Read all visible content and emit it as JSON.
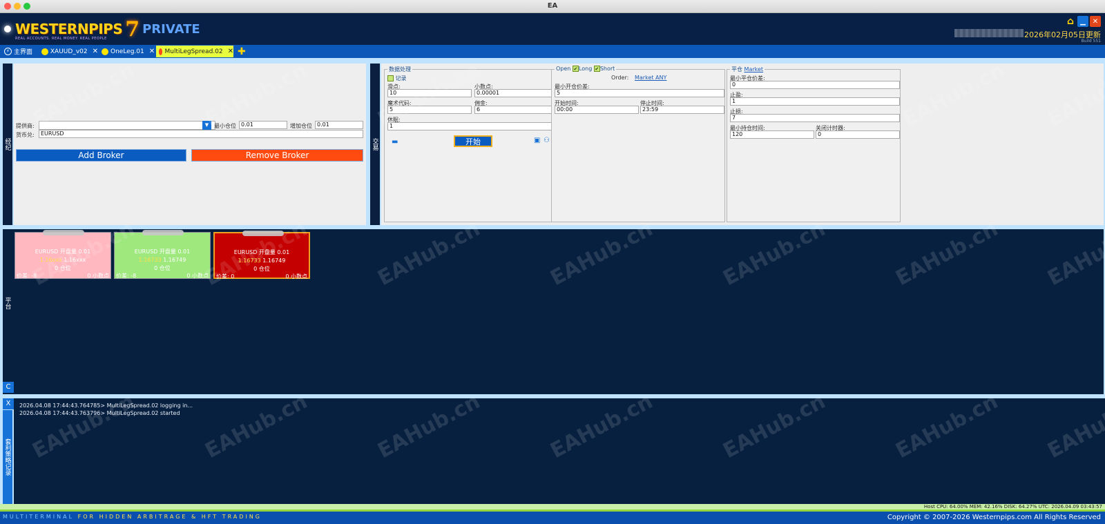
{
  "window": {
    "title": "EA"
  },
  "header": {
    "logo_western": "WESTERNPIPS",
    "logo_seven": "7",
    "logo_private": "PRIVATE",
    "logo_tagline": "REAL ACCOUNTS. REAL MONEY. REAL PEOPLE",
    "date": "2026年02月05日更新",
    "build": "Build 551"
  },
  "tabs": [
    {
      "label": "主界面"
    },
    {
      "label": "XAUUD_v02"
    },
    {
      "label": "OneLeg.01"
    },
    {
      "label": "MultiLegSpread.02"
    }
  ],
  "broker_panel": {
    "side_label": "经纪",
    "provider_label": "提供商:",
    "provider_value": "",
    "min_lot_label": "最小仓位",
    "min_lot_value": "0.01",
    "add_lot_label": "增加仓位",
    "add_lot_value": "0.01",
    "pair_label": "货币兑:",
    "pair_value": "EURUSD",
    "add_broker": "Add Broker",
    "remove_broker": "Remove Broker"
  },
  "trade_panel": {
    "side_label": "交易",
    "data": {
      "title": "数据处理",
      "log_label": "记录",
      "slippage_label": "滑点:",
      "slippage_value": "10",
      "decimals_label": "小数点:",
      "decimals_value": "0.00001",
      "magic_label": "魔术代码:",
      "magic_value": "5",
      "commission_label": "佣金:",
      "commission_value": "6",
      "rest_label": "休眠:",
      "rest_value": "1",
      "start_button": "开始"
    },
    "open": {
      "title": "Open",
      "long": "Long",
      "short": "Short",
      "order_label": "Order:",
      "order_value": "Market ANY",
      "min_open_label": "最小开仓价差:",
      "min_open_value": "5",
      "start_time_label": "开始时间:",
      "start_time_value": "00:00",
      "stop_time_label": "停止时间:",
      "stop_time_value": "23:59"
    },
    "close": {
      "title": "平仓",
      "mode": "Market",
      "min_close_label": "最小平仓价差:",
      "min_close_value": "0",
      "tp_label": "止盈:",
      "tp_value": "1",
      "sl_label": "止损:",
      "sl_value": "7",
      "min_hold_label": "最小持仓时间:",
      "min_hold_value": "120",
      "close_timer_label": "关闭计时器:",
      "close_timer_value": "0"
    }
  },
  "platform_panel": {
    "side_label": "平台",
    "c_button": "C",
    "cards": [
      {
        "name": "EURUSD 开盘量 0.01",
        "bid": "1.16xxx",
        "ask": "1.16xxx",
        "pos": "0 仓位",
        "spread_label": "价差: -8",
        "decimals": "0 小数点",
        "bg": "#ffb8c0",
        "text": "#ffffff"
      },
      {
        "name": "EURUSD 开盘量 0.01",
        "bid": "1.16733",
        "ask": "1.16749",
        "pos": "0 仓位",
        "spread_label": "价差: -8",
        "decimals": "0 小数点",
        "bg": "#9ee87e",
        "text": "#ffffff"
      },
      {
        "name": "EURUSD 开盘量 0.01",
        "bid": "1.16733",
        "ask": "1.16749",
        "pos": "0 仓位",
        "spread_label": "价差: 0",
        "decimals": "0 小数点",
        "bg": "#c40000",
        "text": "#ffffff"
      }
    ]
  },
  "log_panel": {
    "side_label": "套利策略记录",
    "close_button": "X",
    "lines": [
      "2026.04.08 17:44:43.764785> MultiLegSpread.02 logging in...",
      "2026.04.08 17:44:43.763796> MultiLegSpread.02 started"
    ]
  },
  "status": {
    "host": "Host CPU: 64.00% MEM: 42.16% DISK: 64.27%  UTC: 2026.04.09 03:43:57"
  },
  "footer": {
    "left_a": "MULTITERMINAL",
    "left_b": "FOR HIDDEN ARBITRAGE & HFT TRADING",
    "right": "Copyright © 2007-2026 Westernpips.com All Rights Reserved"
  },
  "watermark": "EAHub.cn",
  "colors": {
    "add_broker": "#0a5cc0",
    "remove_broker": "#ff4a10",
    "start_button": "#0a5cc0"
  }
}
